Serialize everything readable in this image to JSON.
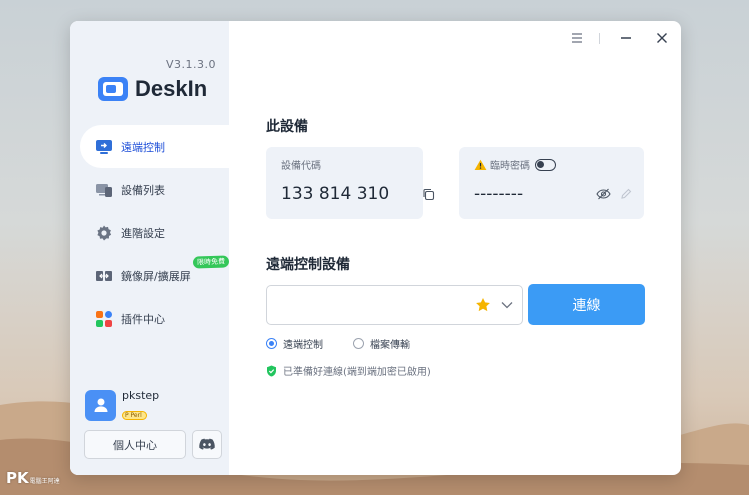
{
  "app": {
    "name": "DeskIn",
    "version": "V3.1.3.0"
  },
  "sidebar": {
    "items": [
      {
        "label": "遠端控制",
        "icon": "remote-control-icon",
        "active": true
      },
      {
        "label": "設備列表",
        "icon": "device-list-icon",
        "active": false
      },
      {
        "label": "進階設定",
        "icon": "gear-icon",
        "active": false
      },
      {
        "label": "鏡像屏/擴展屏",
        "icon": "mirror-screen-icon",
        "active": false,
        "badge": "限時免費"
      },
      {
        "label": "插件中心",
        "icon": "plugin-icon",
        "active": false
      }
    ]
  },
  "user": {
    "name": "pkstep",
    "tier": "Perl",
    "profile_label": "個人中心"
  },
  "this_device": {
    "title": "此設備",
    "code_label": "設備代碼",
    "code_value": "133 814 310",
    "password_label": "臨時密碼",
    "password_value": "--------"
  },
  "remote": {
    "title": "遠端控制設備",
    "input_placeholder": "",
    "connect_label": "連線",
    "modes": [
      {
        "label": "遠端控制",
        "selected": true
      },
      {
        "label": "檔案傳輸",
        "selected": false
      }
    ],
    "status": "已準備好連線(端到端加密已啟用)"
  },
  "colors": {
    "accent": "#3b9bf5",
    "sidebar_bg": "#eef2f8",
    "badge": "#34c759",
    "star": "#f5b400"
  },
  "watermark": {
    "text": "PK",
    "sub": "電腦王阿達"
  }
}
